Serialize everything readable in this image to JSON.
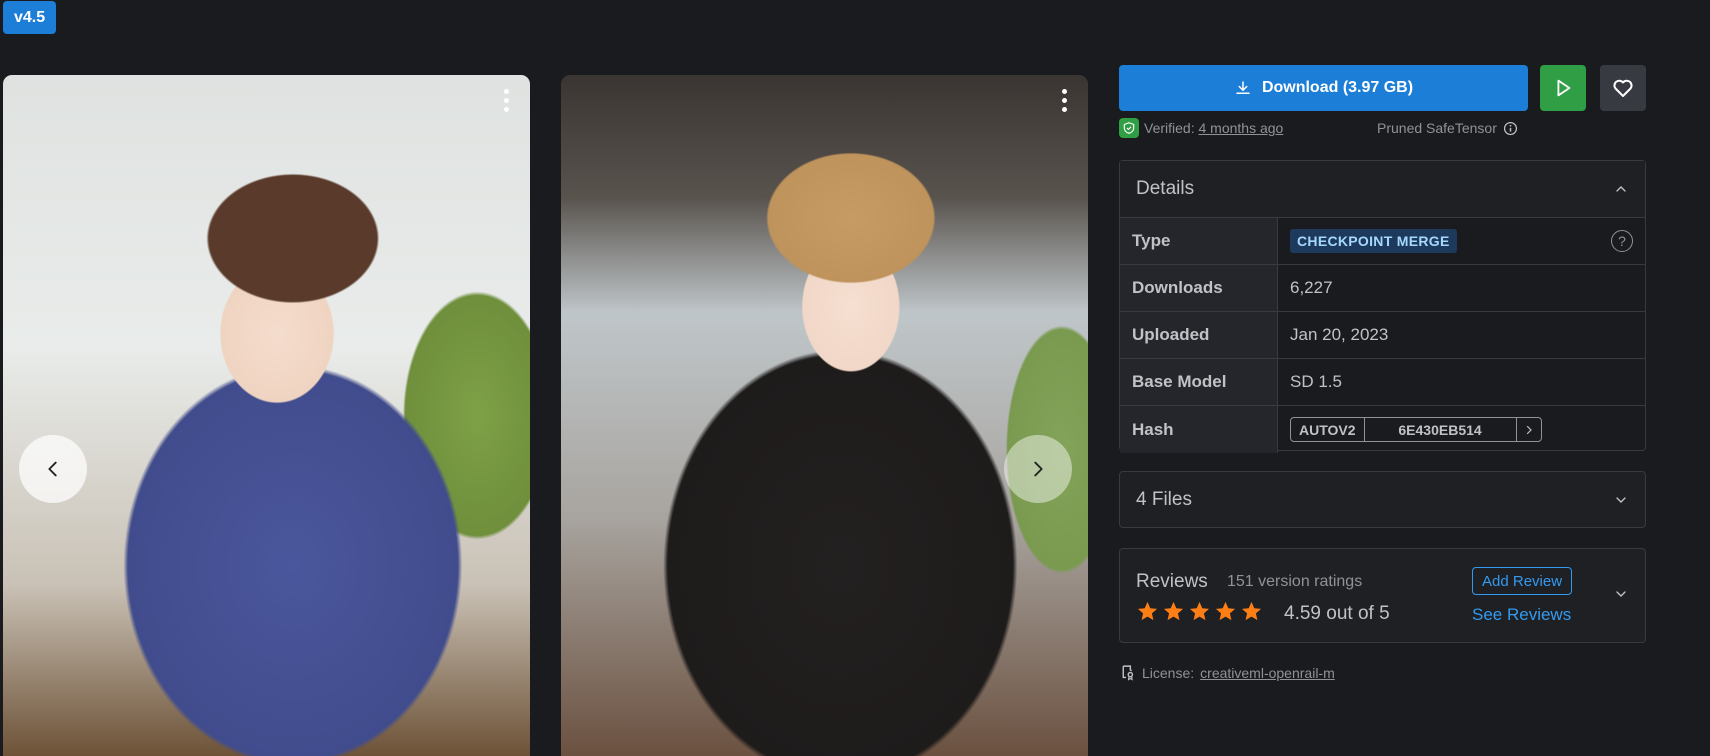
{
  "version_badge": "v4.5",
  "gallery": {
    "prev_icon": "chevron-left-icon",
    "next_icon": "chevron-right-icon",
    "menu_icon": "dots-vertical-icon"
  },
  "actions": {
    "download_label": "Download (3.97 GB)",
    "download_icon": "download-icon",
    "run_icon": "play-icon",
    "fav_icon": "heart-icon"
  },
  "verified": {
    "label": "Verified:",
    "when": "4 months ago",
    "format": "Pruned SafeTensor"
  },
  "details": {
    "title": "Details",
    "type_key": "Type",
    "type_value": "CHECKPOINT MERGE",
    "downloads_key": "Downloads",
    "downloads_value": "6,227",
    "uploaded_key": "Uploaded",
    "uploaded_value": "Jan 20, 2023",
    "base_model_key": "Base Model",
    "base_model_value": "SD 1.5",
    "hash_key": "Hash",
    "hash_type": "AUTOV2",
    "hash_value": "6E430EB514"
  },
  "files": {
    "title": "4 Files"
  },
  "reviews": {
    "title": "Reviews",
    "count": "151 version ratings",
    "rating": 4.59,
    "rating_text": "4.59 out of 5",
    "add_label": "Add Review",
    "see_label": "See Reviews",
    "star_color": "#fd7e14"
  },
  "license": {
    "label": "License:",
    "name": "creativeml-openrail-m"
  },
  "colors": {
    "primary": "#1c7ed6",
    "success": "#2f9e44",
    "link": "#339af0",
    "background": "#1a1b1e"
  }
}
